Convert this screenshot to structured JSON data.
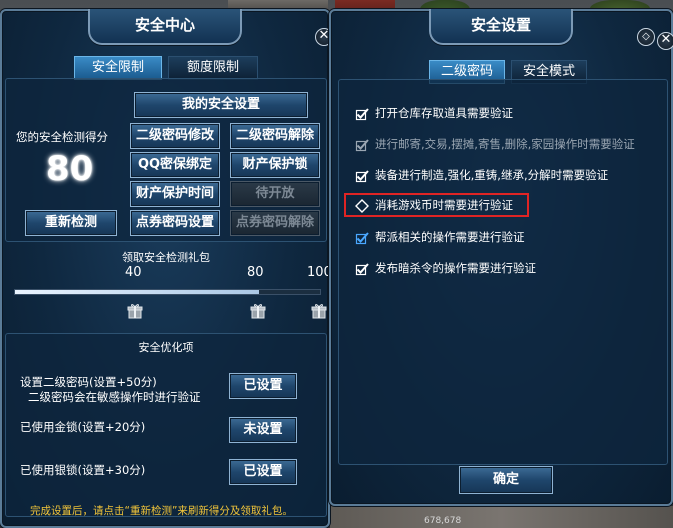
{
  "left_panel": {
    "title": "安全中心",
    "tabs": [
      {
        "label": "安全限制",
        "active": true
      },
      {
        "label": "额度限制",
        "active": false
      }
    ],
    "my_settings_button": "我的安全设置",
    "score_label": "您的安全检测得分",
    "score": "80",
    "recheck_button": "重新检测",
    "grid_buttons": [
      {
        "label": "二级密码修改",
        "enabled": true
      },
      {
        "label": "二级密码解除",
        "enabled": true
      },
      {
        "label": "QQ密保绑定",
        "enabled": true
      },
      {
        "label": "财产保护锁",
        "enabled": true
      },
      {
        "label": "财产保护时间",
        "enabled": true
      },
      {
        "label": "待开放",
        "enabled": false
      },
      {
        "label": "点券密码设置",
        "enabled": true
      },
      {
        "label": "点券密码解除",
        "enabled": false
      }
    ],
    "gift_section": {
      "title": "领取安全检测礼包",
      "milestones": [
        "40",
        "80",
        "100"
      ],
      "progress_fraction": 0.8
    },
    "optimize_section": {
      "title": "安全优化项",
      "items": [
        {
          "text": "设置二级密码(设置+50分)",
          "subtext": "二级密码会在敏感操作时进行验证",
          "button": "已设置"
        },
        {
          "text": "已使用金锁(设置+20分)",
          "subtext": "",
          "button": "未设置"
        },
        {
          "text": "已使用银锁(设置+30分)",
          "subtext": "",
          "button": "已设置"
        }
      ]
    },
    "footer_note": "完成设置后，请点击“重新检测”来刷新得分及领取礼包。"
  },
  "right_panel": {
    "title": "安全设置",
    "tabs": [
      {
        "label": "二级密码",
        "active": true
      },
      {
        "label": "安全模式",
        "active": false
      }
    ],
    "options": [
      {
        "label": "打开仓库存取道具需要验证",
        "checked": true,
        "enabled": true,
        "style": "white"
      },
      {
        "label": "进行邮寄,交易,摆摊,寄售,删除,家园操作时需要验证",
        "checked": true,
        "enabled": false,
        "style": "grey"
      },
      {
        "label": "装备进行制造,强化,重铸,继承,分解时需要验证",
        "checked": true,
        "enabled": true,
        "style": "white"
      },
      {
        "label": "消耗游戏币时需要进行验证",
        "checked": false,
        "enabled": true,
        "style": "white"
      },
      {
        "label": "帮派相关的操作需要进行验证",
        "checked": true,
        "enabled": true,
        "style": "blue"
      },
      {
        "label": "发布暗杀令的操作需要进行验证",
        "checked": true,
        "enabled": true,
        "style": "white"
      }
    ],
    "highlighted_option_index": 3,
    "confirm_button": "确定"
  },
  "background": {
    "coordinates": "678,678"
  },
  "colors": {
    "panel_bg": "#0f2840",
    "panel_border": "#5b7c98",
    "tab_active": "#3a8bc6",
    "button_face": "#1f466c",
    "note_text": "#f0c43a",
    "highlight_border": "#e02424"
  },
  "icons": {
    "close": "close-icon",
    "gift": "gift-box-icon",
    "check": "checkmark-icon"
  }
}
